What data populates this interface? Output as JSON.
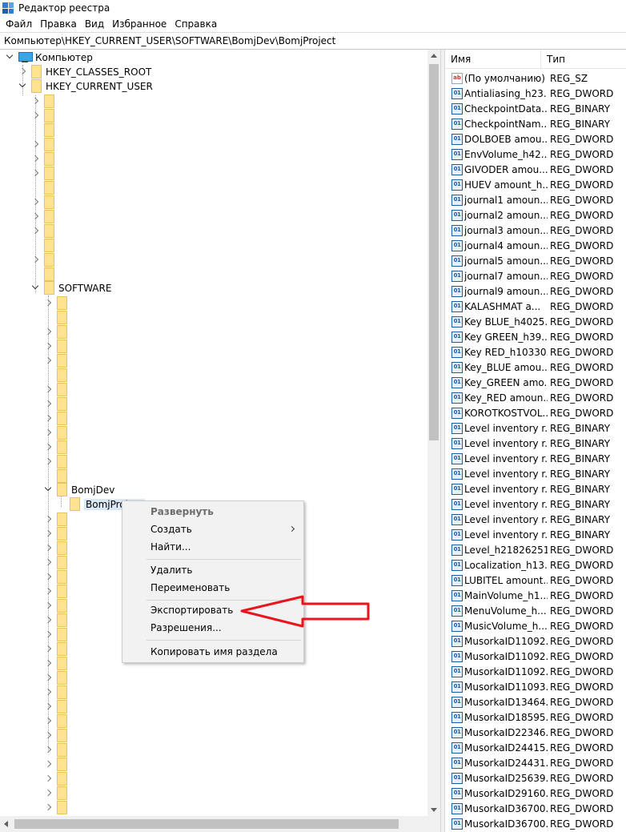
{
  "window": {
    "title": "Редактор реестра"
  },
  "menu": [
    "Файл",
    "Правка",
    "Вид",
    "Избранное",
    "Справка"
  ],
  "address": "Компьютер\\HKEY_CURRENT_USER\\SOFTWARE\\BomjDev\\BomjProject",
  "tree": {
    "computer": "Компьютер",
    "hkcr": "HKEY_CLASSES_ROOT",
    "hkcu": "HKEY_CURRENT_USER",
    "software": "SOFTWARE",
    "bomjdev": "BomjDev",
    "bomjproject": "BomjProject"
  },
  "values_header": {
    "name": "Имя",
    "type": "Тип"
  },
  "values": [
    {
      "icon": "string-value-icon",
      "name": "(По умолчанию)",
      "type": "REG_SZ"
    },
    {
      "icon": "binary-value-icon",
      "name": "Antialiasing_h23...",
      "type": "REG_DWORD"
    },
    {
      "icon": "binary-value-icon",
      "name": "CheckpointData...",
      "type": "REG_BINARY"
    },
    {
      "icon": "binary-value-icon",
      "name": "CheckpointNam...",
      "type": "REG_BINARY"
    },
    {
      "icon": "binary-value-icon",
      "name": "DOLBOEB amou...",
      "type": "REG_DWORD"
    },
    {
      "icon": "binary-value-icon",
      "name": "EnvVolume_h42...",
      "type": "REG_DWORD"
    },
    {
      "icon": "binary-value-icon",
      "name": "GIVODER amou...",
      "type": "REG_DWORD"
    },
    {
      "icon": "binary-value-icon",
      "name": "HUEV amount_h...",
      "type": "REG_DWORD"
    },
    {
      "icon": "binary-value-icon",
      "name": "journal1 amoun...",
      "type": "REG_DWORD"
    },
    {
      "icon": "binary-value-icon",
      "name": "journal2 amoun...",
      "type": "REG_DWORD"
    },
    {
      "icon": "binary-value-icon",
      "name": "journal3 amoun...",
      "type": "REG_DWORD"
    },
    {
      "icon": "binary-value-icon",
      "name": "journal4 amoun...",
      "type": "REG_DWORD"
    },
    {
      "icon": "binary-value-icon",
      "name": "journal5 amoun...",
      "type": "REG_DWORD"
    },
    {
      "icon": "binary-value-icon",
      "name": "journal7 amoun...",
      "type": "REG_DWORD"
    },
    {
      "icon": "binary-value-icon",
      "name": "journal9 amoun...",
      "type": "REG_DWORD"
    },
    {
      "icon": "binary-value-icon",
      "name": "KALASHMAT a...",
      "type": "REG_DWORD"
    },
    {
      "icon": "binary-value-icon",
      "name": "Key BLUE_h4025...",
      "type": "REG_DWORD"
    },
    {
      "icon": "binary-value-icon",
      "name": "Key GREEN_h39...",
      "type": "REG_DWORD"
    },
    {
      "icon": "binary-value-icon",
      "name": "Key RED_h10330...",
      "type": "REG_DWORD"
    },
    {
      "icon": "binary-value-icon",
      "name": "Key_BLUE amou...",
      "type": "REG_DWORD"
    },
    {
      "icon": "binary-value-icon",
      "name": "Key_GREEN amo...",
      "type": "REG_DWORD"
    },
    {
      "icon": "binary-value-icon",
      "name": "Key_RED amoun...",
      "type": "REG_DWORD"
    },
    {
      "icon": "binary-value-icon",
      "name": "KOROTKOSTVOL...",
      "type": "REG_DWORD"
    },
    {
      "icon": "binary-value-icon",
      "name": "Level inventory r...",
      "type": "REG_BINARY"
    },
    {
      "icon": "binary-value-icon",
      "name": "Level inventory r...",
      "type": "REG_BINARY"
    },
    {
      "icon": "binary-value-icon",
      "name": "Level inventory r...",
      "type": "REG_BINARY"
    },
    {
      "icon": "binary-value-icon",
      "name": "Level inventory r...",
      "type": "REG_BINARY"
    },
    {
      "icon": "binary-value-icon",
      "name": "Level inventory r...",
      "type": "REG_BINARY"
    },
    {
      "icon": "binary-value-icon",
      "name": "Level inventory r...",
      "type": "REG_BINARY"
    },
    {
      "icon": "binary-value-icon",
      "name": "Level inventory r...",
      "type": "REG_BINARY"
    },
    {
      "icon": "binary-value-icon",
      "name": "Level inventory r...",
      "type": "REG_BINARY"
    },
    {
      "icon": "binary-value-icon",
      "name": "Level_h218262515",
      "type": "REG_DWORD"
    },
    {
      "icon": "binary-value-icon",
      "name": "Localization_h13...",
      "type": "REG_DWORD"
    },
    {
      "icon": "binary-value-icon",
      "name": "LUBITEL amount...",
      "type": "REG_DWORD"
    },
    {
      "icon": "binary-value-icon",
      "name": "MainVolume_h1...",
      "type": "REG_DWORD"
    },
    {
      "icon": "binary-value-icon",
      "name": "MenuVolume_h...",
      "type": "REG_DWORD"
    },
    {
      "icon": "binary-value-icon",
      "name": "MusicVolume_h...",
      "type": "REG_DWORD"
    },
    {
      "icon": "binary-value-icon",
      "name": "MusorkaID11092...",
      "type": "REG_DWORD"
    },
    {
      "icon": "binary-value-icon",
      "name": "MusorkaID11092...",
      "type": "REG_DWORD"
    },
    {
      "icon": "binary-value-icon",
      "name": "MusorkaID11092...",
      "type": "REG_DWORD"
    },
    {
      "icon": "binary-value-icon",
      "name": "MusorkaID11093...",
      "type": "REG_DWORD"
    },
    {
      "icon": "binary-value-icon",
      "name": "MusorkaID13464...",
      "type": "REG_DWORD"
    },
    {
      "icon": "binary-value-icon",
      "name": "MusorkaID18595...",
      "type": "REG_DWORD"
    },
    {
      "icon": "binary-value-icon",
      "name": "MusorkaID22346...",
      "type": "REG_DWORD"
    },
    {
      "icon": "binary-value-icon",
      "name": "MusorkaID24415...",
      "type": "REG_DWORD"
    },
    {
      "icon": "binary-value-icon",
      "name": "MusorkaID24431...",
      "type": "REG_DWORD"
    },
    {
      "icon": "binary-value-icon",
      "name": "MusorkaID25639...",
      "type": "REG_DWORD"
    },
    {
      "icon": "binary-value-icon",
      "name": "MusorkaID29160...",
      "type": "REG_DWORD"
    },
    {
      "icon": "binary-value-icon",
      "name": "MusorkaID36700...",
      "type": "REG_DWORD"
    },
    {
      "icon": "binary-value-icon",
      "name": "MusorkaID36700...",
      "type": "REG_DWORD"
    }
  ],
  "context_menu": {
    "expand": "Развернуть",
    "create": "Создать",
    "find": "Найти...",
    "delete": "Удалить",
    "rename": "Переименовать",
    "export": "Экспортировать",
    "permissions": "Разрешения...",
    "copy_key_name": "Копировать имя раздела"
  },
  "colors": {
    "annotation_arrow": "#e8141e",
    "folder": "#ffe38f",
    "selection": "#d9e8f7"
  }
}
